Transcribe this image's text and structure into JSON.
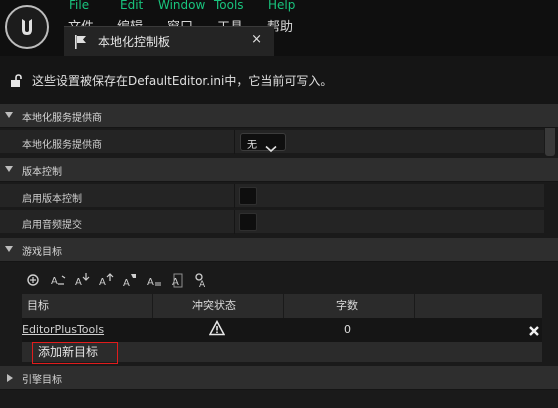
{
  "menu": {
    "english": [
      "File",
      "Edit",
      "Window",
      "Tools",
      "Help"
    ],
    "chinese": [
      "文件",
      "编辑",
      "窗口",
      "工具",
      "帮助"
    ]
  },
  "tab": {
    "title": "本地化控制板",
    "close_glyph": "×",
    "icon": "flag-icon"
  },
  "notice": {
    "icon": "lock-open-icon",
    "text": "这些设置被保存在DefaultEditor.ini中，它当前可写入。"
  },
  "sections": {
    "provider": {
      "title": "本地化服务提供商",
      "row_label": "本地化服务提供商",
      "combo_value": "无"
    },
    "version_control": {
      "title": "版本控制",
      "enable_label": "启用版本控制",
      "enable_checked": false,
      "autosubmit_label": "启用音频提交",
      "autosubmit_checked": false
    },
    "game_targets": {
      "title": "游戏目标",
      "toolbar_icons": [
        "gather-text-icon",
        "edit-text-icon",
        "import-text-icon",
        "export-text-icon",
        "import-dialogue-icon",
        "export-dialogue-icon",
        "compile-text-icon",
        "count-words-icon"
      ],
      "columns": [
        "目标",
        "冲突状态",
        "字数"
      ],
      "rows": [
        {
          "target": "EditorPlusTools",
          "conflict_icon": "warning-icon",
          "word_count": "0",
          "delete_icon": "delete-icon"
        }
      ],
      "add_button": "添加新目标"
    },
    "engine_targets": {
      "title": "引擎目标"
    }
  },
  "colors": {
    "menu_english": "#19c37d",
    "accent": "#2a7cd5",
    "highlight_border": "#e01c1c"
  }
}
